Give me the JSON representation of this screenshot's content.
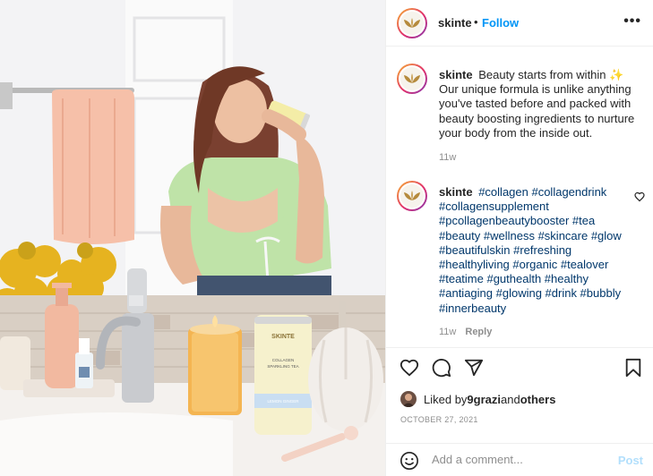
{
  "header": {
    "username": "skinte",
    "separator": "•",
    "follow_label": "Follow",
    "more_icon": "more-horizontal-icon",
    "more_label": "•••"
  },
  "caption": {
    "username": "skinte",
    "text": "Beauty starts from within ✨ Our unique formula is unlike anything you've tasted before and packed with beauty boosting ingredients to nurture your body from the inside out.",
    "age": "11w"
  },
  "comment": {
    "username": "skinte",
    "hashtags": "#collagen #collagendrink #collagensupplement #pcollagenbeautybooster #tea #beauty #wellness #skincare #glow #beautifulskin #refreshing #healthyliving #organic #tealover #teatime #guthealth #healthy #antiaging #glowing #drink #bubbly #innerbeauty",
    "age": "11w",
    "reply_label": "Reply"
  },
  "likes": {
    "prefix": "Liked by ",
    "user": "9grazi",
    "middle": " and ",
    "others": "others"
  },
  "date": "OCTOBER 27, 2021",
  "add_comment": {
    "placeholder": "Add a comment...",
    "post_label": "Post"
  },
  "product": {
    "brand": "SKINTE",
    "line1": "COLLAGEN",
    "line2": "SPARKLING TEA",
    "flavor": "LEMON GINGER"
  },
  "colors": {
    "follow": "#0095f6",
    "hashtag": "#00376b",
    "muted": "#8e8e8e",
    "post_disabled": "#b2dffc",
    "logo_leaf": "#b58a3c"
  }
}
